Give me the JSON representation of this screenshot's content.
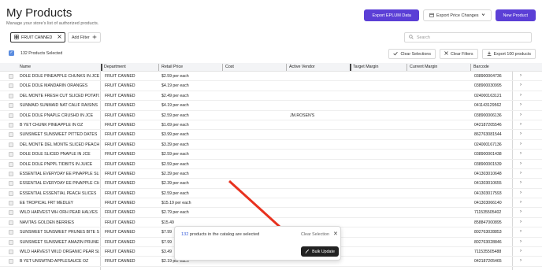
{
  "header": {
    "title": "My Products",
    "subtitle": "Manage your store's list of authorized products."
  },
  "actions": {
    "export_eplum": "Export EPLUM Data",
    "export_price_changes": "Export Price Changes",
    "new_product": "New Product"
  },
  "filters": {
    "chip_label": "FRUIT CANNED",
    "add_filter": "Add Filter",
    "search_placeholder": "Search"
  },
  "selection": {
    "count_text": "132 Products Selected",
    "clear_selections": "Clear Selections",
    "clear_filters": "Clear Filters",
    "export_products": "Export 100 products"
  },
  "table": {
    "columns": [
      "Name",
      "Department",
      "Retail Price",
      "Cost",
      "Active Vendor",
      "Target Margin",
      "Current Margin",
      "Barcode"
    ],
    "rows": [
      {
        "name": "DOLE DOLE PINEAPPLE CHUNKS IN JCE",
        "dept": "FRUIT CANNED",
        "price": "$2.59 per each",
        "vendor": "",
        "barcode": "038900004736"
      },
      {
        "name": "DOLE DOLE MANDARIN ORANGES",
        "dept": "FRUIT CANNED",
        "price": "$4.19 per each",
        "vendor": "",
        "barcode": "038900030995"
      },
      {
        "name": "DEL MONTE FRESH CUT SLICED POTATOES",
        "dept": "FRUIT CANNED",
        "price": "$2.49 per each",
        "vendor": "",
        "barcode": "024000163121"
      },
      {
        "name": "SUNMAID SUNMAID NAT CALIF RAISINS",
        "dept": "FRUIT CANNED",
        "price": "$4.19 per each",
        "vendor": "",
        "barcode": "041143129562"
      },
      {
        "name": "DOLE DOLE PNAPLE CRUSHD IN JCE",
        "dept": "FRUIT CANNED",
        "price": "$2.59 per each",
        "vendor": "JM.ROSEN'S",
        "barcode": "038900006136"
      },
      {
        "name": "B YET CHUNK PINEAPPLE IN OZ",
        "dept": "FRUIT CANNED",
        "price": "$1.69 per each",
        "vendor": "",
        "barcode": "042187205546"
      },
      {
        "name": "SUNSWEET SUNSWEET PITTED DATES",
        "dept": "FRUIT CANNED",
        "price": "$3.99 per each",
        "vendor": "",
        "barcode": "862763081544"
      },
      {
        "name": "DEL MONTE DEL MONTE SLICED PEACHES",
        "dept": "FRUIT CANNED",
        "price": "$3.39 per each",
        "vendor": "",
        "barcode": "024000167136"
      },
      {
        "name": "DOLE DOLE SLICED PNAPLE IN JCE",
        "dept": "FRUIT CANNED",
        "price": "$2.59 per each",
        "vendor": "",
        "barcode": "038900001438"
      },
      {
        "name": "DOLE DOLE PNPPL TIDBITS IN JUICE",
        "dept": "FRUIT CANNED",
        "price": "$2.59 per each",
        "vendor": "",
        "barcode": "038900001539"
      },
      {
        "name": "ESSENTIAL EVERYDAY EE PINAPPLE SLICES",
        "dept": "FRUIT CANNED",
        "price": "$2.39 per each",
        "vendor": "",
        "barcode": "041303010648"
      },
      {
        "name": "ESSENTIAL EVERYDAY EE PINAPPLE CHUNKS",
        "dept": "FRUIT CANNED",
        "price": "$2.39 per each",
        "vendor": "",
        "barcode": "041303010655"
      },
      {
        "name": "ESSENTIAL ESSENTIAL PEACH SLICES",
        "dept": "FRUIT CANNED",
        "price": "$2.59 per each",
        "vendor": "",
        "barcode": "041303017593"
      },
      {
        "name": "EE TROPICAL FRT MEDLEY",
        "dept": "FRUIT CANNED",
        "price": "$15.19 per each",
        "vendor": "",
        "barcode": "041303066140"
      },
      {
        "name": "WILD HARVEST WH ORH PEAR HALVES",
        "dept": "FRUIT CANNED",
        "price": "$2.79 per each",
        "vendor": "",
        "barcode": "711535505402"
      },
      {
        "name": "NAVITAS GOLDEN BERRIES",
        "dept": "FRUIT CANNED",
        "price": "$15.49",
        "vendor": "",
        "barcode": "858847000895"
      },
      {
        "name": "SUNSWEET SUNSWEET PRUNES BITE SIZE",
        "dept": "FRUIT CANNED",
        "price": "$7.99",
        "vendor": "",
        "barcode": "802763028853"
      },
      {
        "name": "SUNSWEET SUNSWEET AMAZIN PRUNES",
        "dept": "FRUIT CANNED",
        "price": "$7.99",
        "vendor": "",
        "barcode": "802763028846"
      },
      {
        "name": "WILD HARVEST WILD ORGANIC PEAR SLICES",
        "dept": "FRUIT CANNED",
        "price": "$3.49",
        "vendor": "",
        "barcode": "711535505488"
      },
      {
        "name": "B YET UNSWTND APPLESAUCE OZ",
        "dept": "FRUIT CANNED",
        "price": "$2.19 per each",
        "vendor": "",
        "barcode": "042187205465"
      }
    ]
  },
  "popup": {
    "count": "132",
    "message": " products in the catalog are selected",
    "clear_selection": "Clear Selection",
    "bulk_update": "Bulk Update"
  },
  "colors": {
    "accent": "#5b3fd6",
    "checkbox": "#5b8de0",
    "arrow": "#e8321f"
  }
}
